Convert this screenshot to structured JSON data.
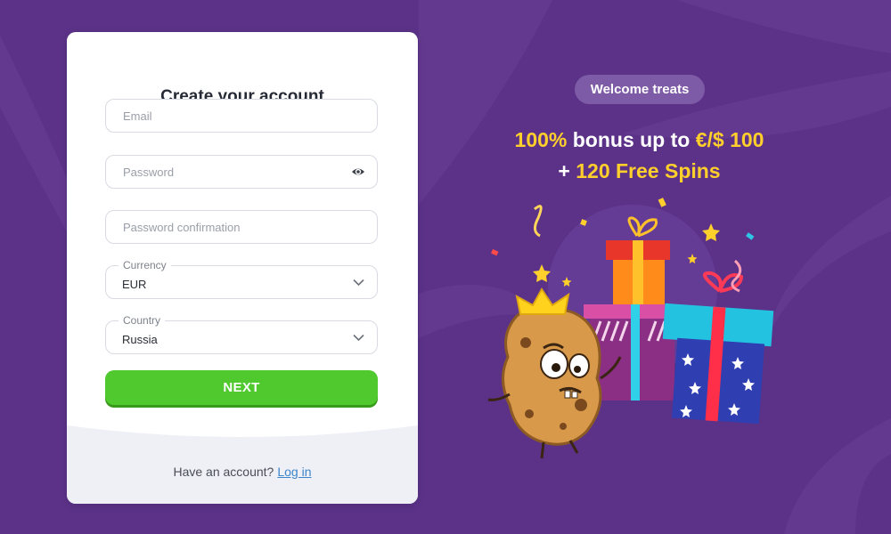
{
  "form": {
    "title": "Create your account",
    "email_placeholder": "Email",
    "password_placeholder": "Password",
    "password_confirm_placeholder": "Password confirmation",
    "currency": {
      "label": "Currency",
      "value": "EUR"
    },
    "country": {
      "label": "Country",
      "value": "Russia"
    },
    "next_label": "NEXT",
    "footer_text": "Have an account?",
    "login_label": "Log in"
  },
  "promo": {
    "badge": "Welcome treats",
    "line1_a": "100%",
    "line1_b": " bonus up to ",
    "line1_c": "€/$ 100",
    "line2_a": "+ ",
    "line2_b": "120 Free Spins"
  },
  "colors": {
    "background": "#5b3288",
    "accent_yellow": "#ffcf2b",
    "button_green": "#4fc92d",
    "link_blue": "#3d84cc",
    "badge_bg": "#7e5ba6"
  },
  "icons": {
    "password_toggle": "eye-icon",
    "select_arrow": "chevron-down-icon"
  }
}
